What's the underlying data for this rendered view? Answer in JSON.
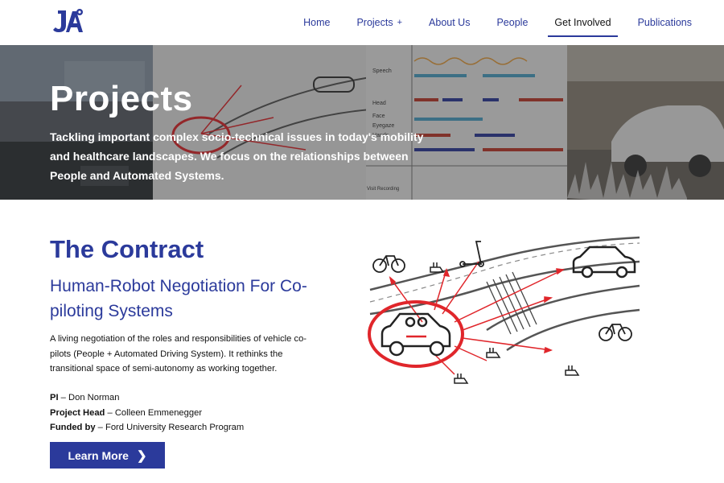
{
  "nav": {
    "items": [
      {
        "label": "Home"
      },
      {
        "label": "Projects",
        "suffix": "+"
      },
      {
        "label": "About Us"
      },
      {
        "label": "People"
      },
      {
        "label": "Get Involved",
        "active": true
      },
      {
        "label": "Publications"
      }
    ]
  },
  "hero": {
    "title": "Projects",
    "description": "Tackling important complex socio-technical issues in today's mobility and healthcare landscapes. We focus on the relationships between People and Automated Systems.",
    "chart_labels": [
      "Speech",
      "Head",
      "Face",
      "Eyegaze",
      "Hands",
      "Visit Recording"
    ]
  },
  "main": {
    "title": "The Contract",
    "subtitle": "Human-Robot Negotiation For Co-piloting Systems",
    "description": "A living negotiation of the roles and responsibilities of vehicle co-pilots (People + Automated Driving System). It rethinks the transitional space of semi-autonomy as working together.",
    "pi_label": "PI",
    "pi_value": " – Don Norman",
    "head_label": "Project Head",
    "head_value": " – Colleen Emmenegger",
    "funded_label": "Funded by",
    "funded_value": " – Ford University Research Program",
    "button_label": "Learn More",
    "button_icon": "chevron-right-icon"
  },
  "colors": {
    "brand": "#2b3a9b",
    "accent_red": "#e0262b"
  }
}
